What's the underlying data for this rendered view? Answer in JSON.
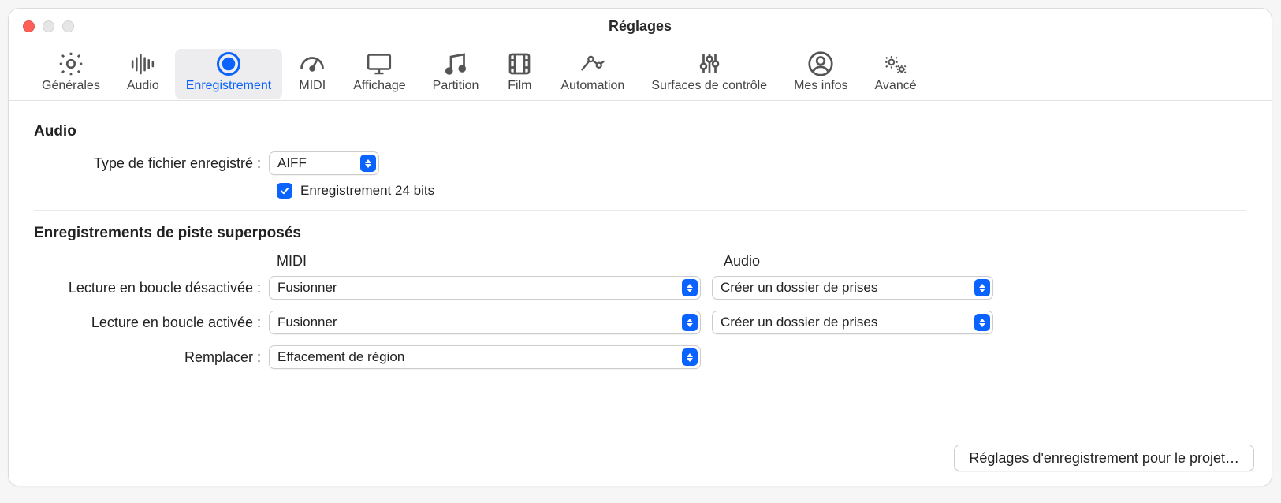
{
  "window": {
    "title": "Réglages"
  },
  "tabs": {
    "generales": "Générales",
    "audio": "Audio",
    "enregistrement": "Enregistrement",
    "midi": "MIDI",
    "affichage": "Affichage",
    "partition": "Partition",
    "film": "Film",
    "automation": "Automation",
    "surfaces": "Surfaces de contrôle",
    "mesinfos": "Mes infos",
    "avance": "Avancé"
  },
  "section_audio": {
    "title": "Audio",
    "file_type_label": "Type de fichier enregistré :",
    "file_type_value": "AIFF",
    "rec24_label": "Enregistrement 24 bits",
    "rec24_checked": true
  },
  "section_overlap": {
    "title": "Enregistrements de piste superposés",
    "col_midi": "MIDI",
    "col_audio": "Audio",
    "row1_label": "Lecture en boucle désactivée :",
    "row1_midi": "Fusionner",
    "row1_audio": "Créer un dossier de prises",
    "row2_label": "Lecture en boucle activée :",
    "row2_midi": "Fusionner",
    "row2_audio": "Créer un dossier de prises",
    "row3_label": "Remplacer :",
    "row3_midi": "Effacement de région"
  },
  "footer": {
    "project_settings": "Réglages d'enregistrement pour le projet…"
  }
}
